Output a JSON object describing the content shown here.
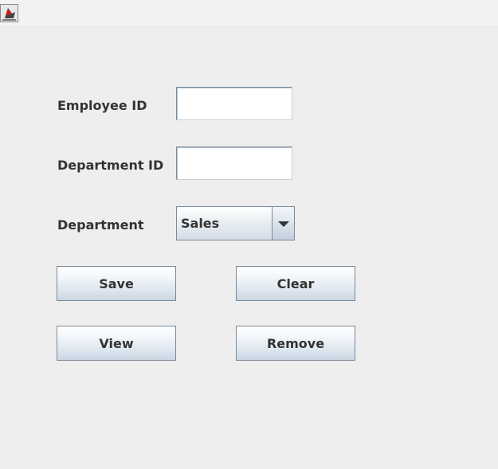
{
  "window": {
    "icon": "java-duke-icon"
  },
  "form": {
    "employee_id": {
      "label": "Employee ID",
      "value": ""
    },
    "department_id": {
      "label": "Department ID",
      "value": ""
    },
    "department": {
      "label": "Department",
      "selected": "Sales"
    }
  },
  "buttons": {
    "save": "Save",
    "clear": "Clear",
    "view": "View",
    "remove": "Remove"
  },
  "colors": {
    "window_bg": "#eeeeee",
    "label_text": "#333333",
    "border": "#7a8a99"
  }
}
